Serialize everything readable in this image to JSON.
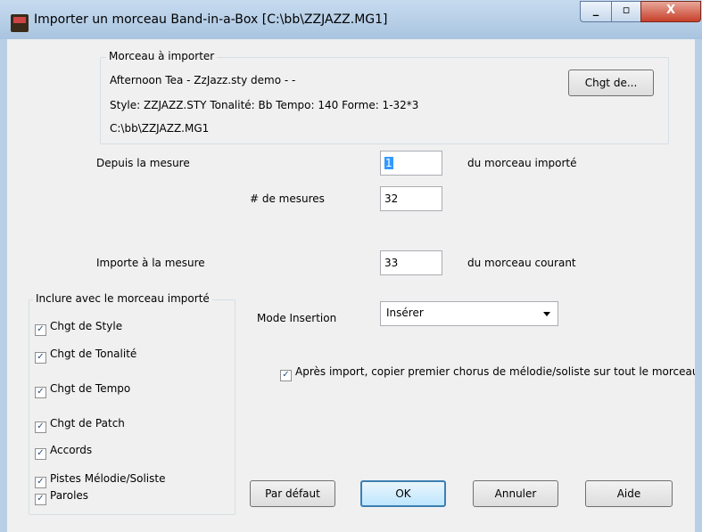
{
  "window": {
    "title": "Importer un morceau Band-in-a-Box [C:\\bb\\ZZJAZZ.MG1]",
    "min_glyph": "_",
    "max_glyph": "▫",
    "close_glyph": "X"
  },
  "source_group": {
    "label": "Morceau à importer",
    "song_line": "Afternoon Tea - ZzJazz.sty demo - -",
    "info_line": "Style: ZZJAZZ.STY  Tonalité: Bb   Tempo: 140  Forme: 1-32*3",
    "path_line": "C:\\bb\\ZZJAZZ.MG1",
    "change_button": "Chgt de..."
  },
  "from_measure": {
    "label": "Depuis la mesure",
    "value": "1",
    "suffix": "du morceau importé"
  },
  "num_measures": {
    "label": "# de mesures",
    "value": "32"
  },
  "import_at": {
    "label": "Importe à la mesure",
    "value": "33",
    "suffix": "du morceau courant"
  },
  "include_group": {
    "label": "Inclure avec le morceau importé",
    "items": [
      {
        "label": "Chgt de Style",
        "checked": true
      },
      {
        "label": "Chgt de Tonalité",
        "checked": true
      },
      {
        "label": "Chgt de Tempo",
        "checked": true
      },
      {
        "label": "Chgt de Patch",
        "checked": true
      },
      {
        "label": "Accords",
        "checked": true
      },
      {
        "label": "Pistes Mélodie/Soliste",
        "checked": true
      },
      {
        "label": "Paroles",
        "checked": true
      }
    ]
  },
  "insert_mode": {
    "label": "Mode Insertion",
    "value": "Insérer"
  },
  "copy_option": {
    "label": "Après import, copier premier chorus de mélodie/soliste sur tout le morceau",
    "checked": true
  },
  "buttons": {
    "default": "Par défaut",
    "ok": "OK",
    "cancel": "Annuler",
    "help": "Aide"
  },
  "check_glyph": "✓"
}
